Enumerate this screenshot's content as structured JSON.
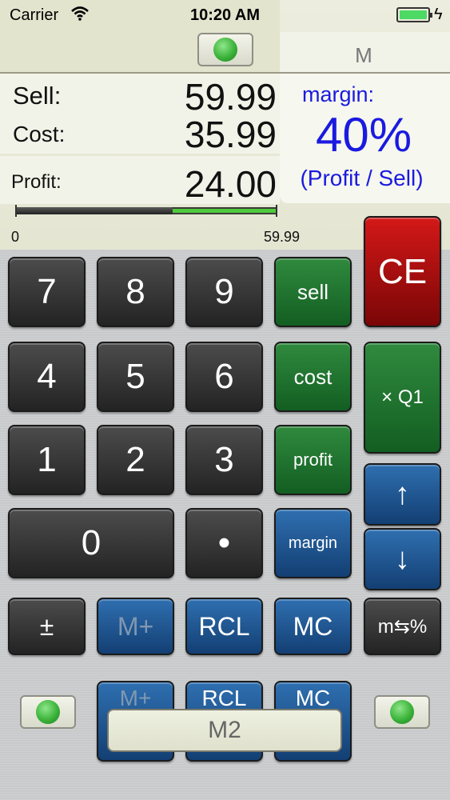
{
  "status_bar": {
    "carrier": "Carrier",
    "time": "10:20 AM"
  },
  "memory_indicator": "M",
  "display": {
    "sell_label": "Sell:",
    "sell_value": "59.99",
    "cost_label": "Cost:",
    "cost_value": "35.99",
    "profit_label": "Profit:",
    "profit_value": "24.00",
    "margin_label": "margin:",
    "margin_value": "40%",
    "margin_formula": "(Profit / Sell)"
  },
  "bar": {
    "min_label": "0",
    "max_label": "59.99",
    "cost_fraction": 0.6,
    "profit_fraction": 0.4
  },
  "keys": {
    "k7": "7",
    "k8": "8",
    "k9": "9",
    "k4": "4",
    "k5": "5",
    "k6": "6",
    "k1": "1",
    "k2": "2",
    "k3": "3",
    "k0": "0",
    "kdot": "•",
    "sell": "sell",
    "cost": "cost",
    "profit": "profit",
    "margin": "margin",
    "ce": "CE",
    "xq1": "× Q1",
    "up": "↑",
    "down": "↓",
    "plusminus": "±",
    "mplus": "M+",
    "rcl": "RCL",
    "mc": "MC",
    "m_pct": "m⇆%"
  },
  "memory2": {
    "mplus": "M+",
    "rcl": "RCL",
    "mc": "MC",
    "label": "M2"
  },
  "colors": {
    "lcd_blue": "#1a1ae0",
    "green_key": "#1e7a30",
    "blue_key": "#1f5590",
    "red_key": "#b10d0d",
    "progress_green": "#4ecb3b"
  }
}
